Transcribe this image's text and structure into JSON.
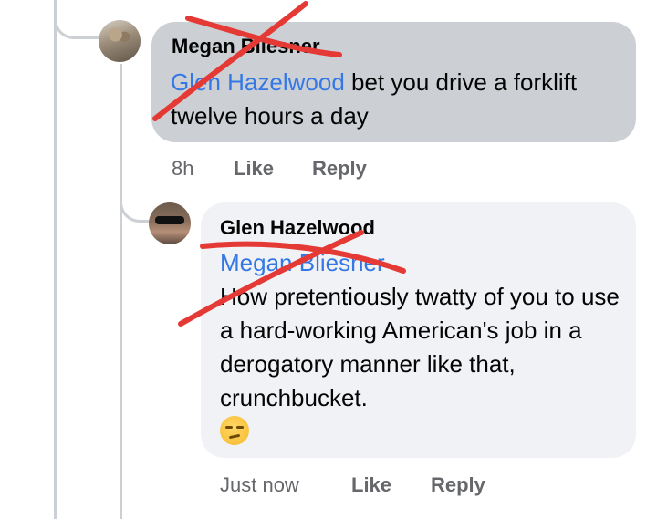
{
  "comments": [
    {
      "author": "Megan Bliesner",
      "mention": "Glen Hazelwood",
      "text_rest": " bet you drive a forklift twelve hours a day",
      "time": "8h",
      "like_label": "Like",
      "reply_label": "Reply"
    },
    {
      "author": "Glen Hazelwood",
      "mention": "Megan Bliesner",
      "text_rest": "How pretentiously twatty of you to use a hard-working American's job in a derogatory manner like that, crunchbucket.",
      "emoji": "unamused-face-icon",
      "time": "Just now",
      "like_label": "Like",
      "reply_label": "Reply"
    }
  ],
  "colors": {
    "mention": "#3578e5",
    "redaction": "#e53935",
    "bubble_highlight": "#ccd0d5",
    "bubble_default": "#f0f2f5",
    "meta": "#65676b"
  }
}
